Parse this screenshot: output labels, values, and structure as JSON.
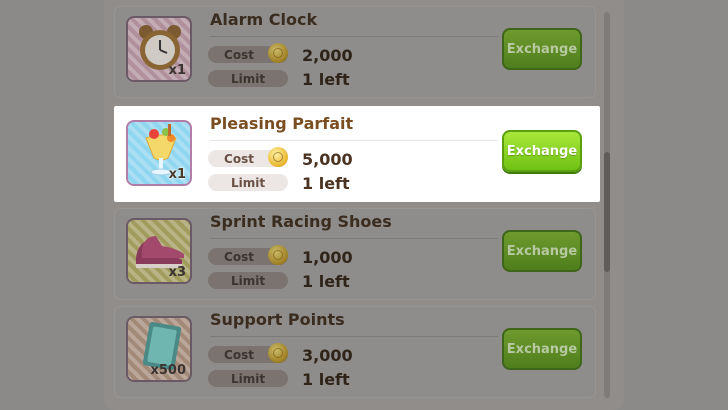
{
  "colors": {
    "accent_green": "#6fc214",
    "title_brown": "#7b4e22",
    "overlay": "#8c8a88"
  },
  "labels": {
    "cost": "Cost",
    "limit": "Limit",
    "exchange": "Exchange"
  },
  "items": [
    {
      "name": "Alarm Clock",
      "quantity": "x1",
      "cost": "2,000",
      "limit": "1 left",
      "icon": "alarm-clock-icon",
      "highlighted": false
    },
    {
      "name": "Pleasing Parfait",
      "quantity": "x1",
      "cost": "5,000",
      "limit": "1 left",
      "icon": "parfait-icon",
      "highlighted": true
    },
    {
      "name": "Sprint Racing Shoes",
      "quantity": "x3",
      "cost": "1,000",
      "limit": "1 left",
      "icon": "racing-shoes-icon",
      "highlighted": false
    },
    {
      "name": "Support Points",
      "quantity": "x500",
      "cost": "3,000",
      "limit": "1 left",
      "icon": "support-points-card-icon",
      "highlighted": false
    }
  ]
}
